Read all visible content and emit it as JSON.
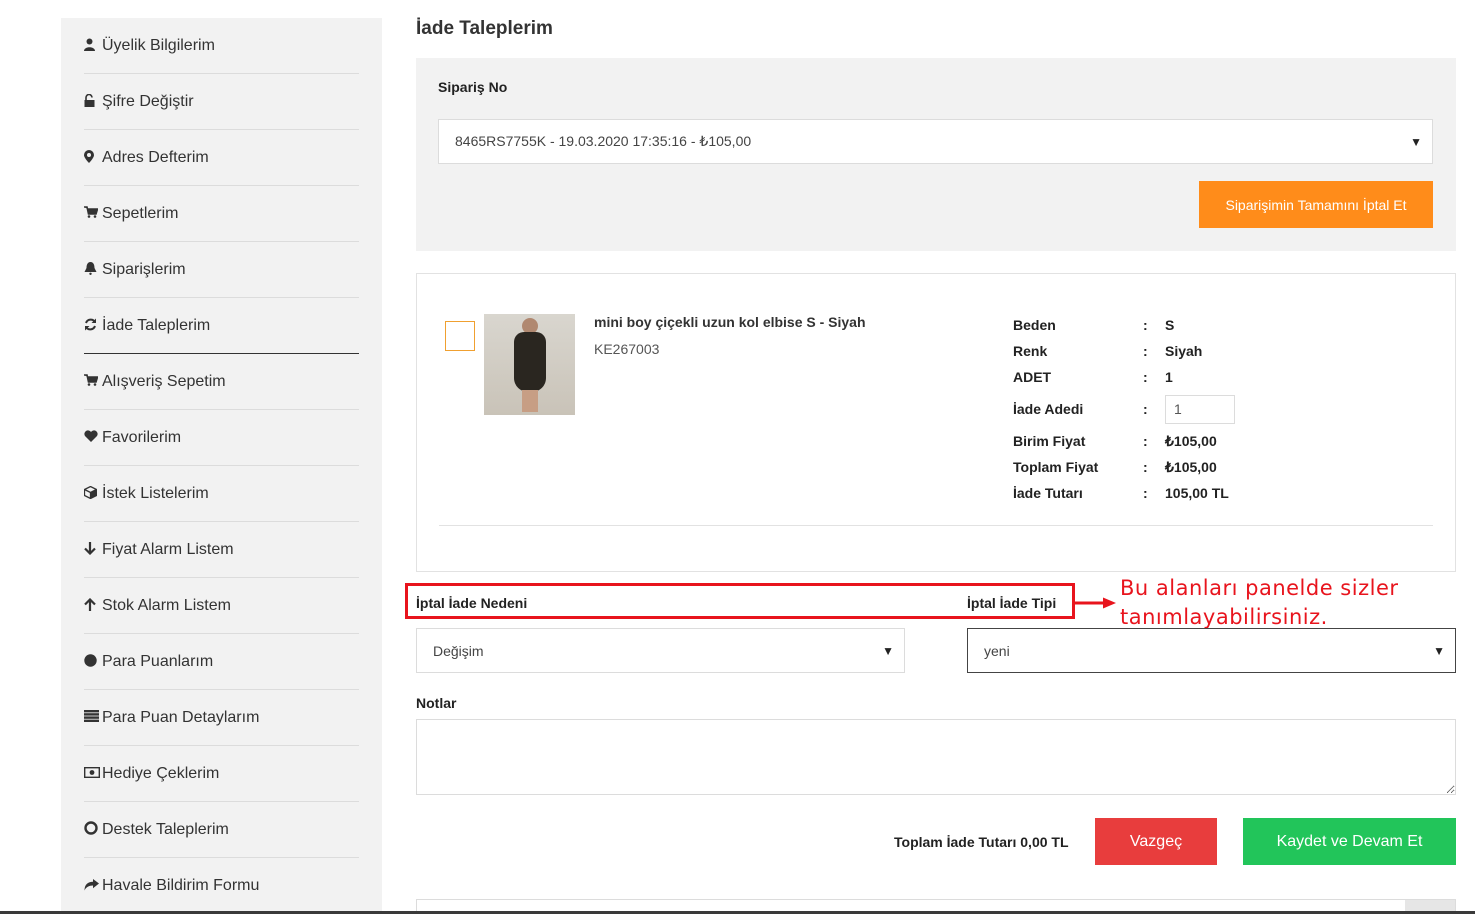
{
  "sidebar": {
    "items": [
      {
        "label": "Üyelik Bilgilerim",
        "icon": "user-icon"
      },
      {
        "label": "Şifre Değiştir",
        "icon": "unlock-icon"
      },
      {
        "label": "Adres Defterim",
        "icon": "map-marker-icon"
      },
      {
        "label": "Sepetlerim",
        "icon": "cart-icon"
      },
      {
        "label": "Siparişlerim",
        "icon": "bell-icon"
      },
      {
        "label": "İade Taleplerim",
        "icon": "refresh-icon"
      },
      {
        "label": "Alışveriş Sepetim",
        "icon": "cart-icon"
      },
      {
        "label": "Favorilerim",
        "icon": "heart-icon"
      },
      {
        "label": "İstek Listelerim",
        "icon": "cube-icon"
      },
      {
        "label": "Fiyat Alarm Listem",
        "icon": "arrow-down-icon"
      },
      {
        "label": "Stok Alarm Listem",
        "icon": "arrow-up-icon"
      },
      {
        "label": "Para Puanlarım",
        "icon": "circle-icon"
      },
      {
        "label": "Para Puan Detaylarım",
        "icon": "list-icon"
      },
      {
        "label": "Hediye Çeklerim",
        "icon": "money-icon"
      },
      {
        "label": "Destek Taleplerim",
        "icon": "life-ring-icon"
      },
      {
        "label": "Havale Bildirim Formu",
        "icon": "share-icon"
      }
    ],
    "active_index": 5
  },
  "main": {
    "title": "İade Taleplerim",
    "order": {
      "label": "Sipariş No",
      "selected": "8465RS7755K - 19.03.2020 17:35:16 - ₺105,00",
      "cancel_all_label": "Siparişimin Tamamını İptal Et"
    },
    "product": {
      "name": "mini boy çiçekli uzun kol elbise S - Siyah",
      "code": "KE267003",
      "specs": {
        "beden_label": "Beden",
        "beden": "S",
        "renk_label": "Renk",
        "renk": "Siyah",
        "adet_label": "ADET",
        "adet": "1",
        "iade_adedi_label": "İade Adedi",
        "iade_adedi": "1",
        "birim_fiyat_label": "Birim Fiyat",
        "birim_fiyat": "₺105,00",
        "toplam_fiyat_label": "Toplam Fiyat",
        "toplam_fiyat": "₺105,00",
        "iade_tutari_label": "İade Tutarı",
        "iade_tutari": "105,00 TL",
        "colon": ":"
      }
    },
    "reason": {
      "label": "İptal İade Nedeni",
      "selected": "Değişim"
    },
    "type": {
      "label": "İptal İade Tipi",
      "selected": "yeni"
    },
    "annotation": {
      "line1": "Bu alanları panelde sizler",
      "line2": "tanımlayabilirsiniz.",
      "color": "#e8141d"
    },
    "notes": {
      "label": "Notlar",
      "value": ""
    },
    "footer": {
      "total_text": "Toplam İade Tutarı 0,00 TL",
      "cancel_label": "Vazgeç",
      "save_label": "Kaydet ve Devam Et"
    }
  },
  "colors": {
    "orange": "#ff8c1a",
    "red": "#e83d3d",
    "green": "#22c55a"
  }
}
